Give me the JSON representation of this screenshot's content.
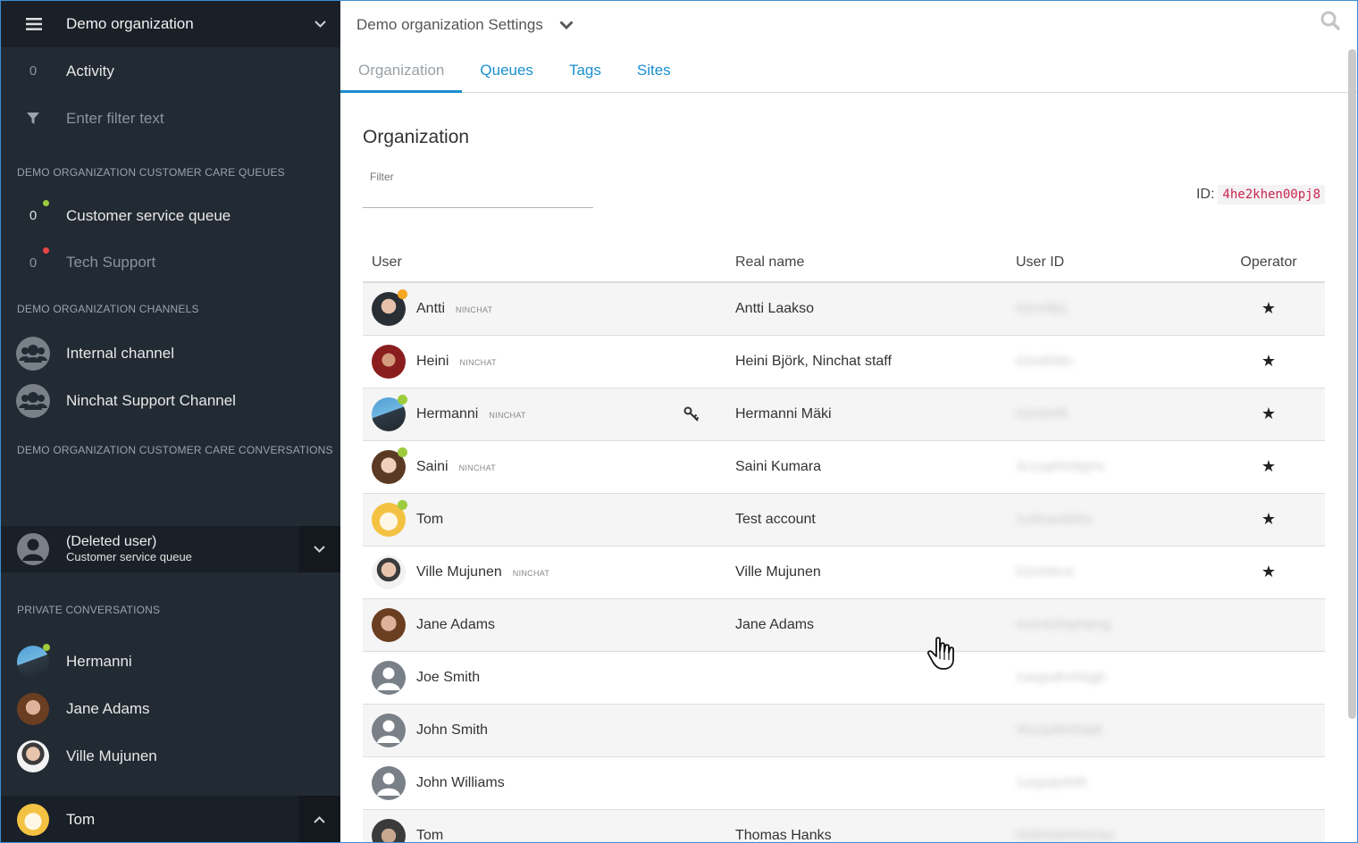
{
  "sidebar": {
    "org_name": "Demo organization",
    "activity": {
      "count": "0",
      "label": "Activity"
    },
    "filter_placeholder": "Enter filter text",
    "queues_section": "DEMO ORGANIZATION CUSTOMER CARE QUEUES",
    "queues": [
      {
        "count": "0",
        "label": "Customer service queue",
        "status_color": "#9ccc3c"
      },
      {
        "count": "0",
        "label": "Tech Support",
        "status_color": "#e84545"
      }
    ],
    "channels_section": "DEMO ORGANIZATION CHANNELS",
    "channels": [
      {
        "label": "Internal channel"
      },
      {
        "label": "Ninchat Support Channel"
      }
    ],
    "conversations_section": "DEMO ORGANIZATION CUSTOMER CARE CONVERSATIONS",
    "conversation": {
      "title": "(Deleted user)",
      "subtitle": "Customer service queue"
    },
    "private_section": "PRIVATE CONVERSATIONS",
    "private": [
      {
        "label": "Hermanni"
      },
      {
        "label": "Jane Adams"
      },
      {
        "label": "Ville Mujunen"
      }
    ],
    "current_user": "Tom"
  },
  "header": {
    "title": "Demo organization Settings",
    "tabs": [
      "Organization",
      "Queues",
      "Tags",
      "Sites"
    ]
  },
  "org": {
    "heading": "Organization",
    "filter_label": "Filter",
    "id_label": "ID:",
    "id_value": "4he2khen00pj8"
  },
  "table": {
    "columns": [
      "User",
      "Real name",
      "User ID",
      "Operator"
    ],
    "rows": [
      {
        "user": "Antti",
        "tag": "NINCHAT",
        "real": "Antti Laakso",
        "uid": "02mrllj0j",
        "operator": "★"
      },
      {
        "user": "Heini",
        "tag": "NINCHAT",
        "real": "Heini Björk, Ninchat staff",
        "uid": "02ml0l4ln",
        "operator": "★"
      },
      {
        "user": "Hermanni",
        "tag": "NINCHAT",
        "real": "Hermanni Mäki",
        "uid": "02ml04ft",
        "operator": "★"
      },
      {
        "user": "Saini",
        "tag": "NINCHAT",
        "real": "Saini Kumara",
        "uid": "3c1sqhh09gHc",
        "operator": "★"
      },
      {
        "user": "Tom",
        "tag": "",
        "real": "Test account",
        "uid": "1ul4naobbhs",
        "operator": "★"
      },
      {
        "user": "Ville Mujunen",
        "tag": "NINCHAT",
        "real": "Ville Mujunen",
        "uid": "02ml0kv4",
        "operator": "★"
      },
      {
        "user": "Jane Adams",
        "tag": "",
        "real": "Jane Adams",
        "uid": "4o3nk2lsphteng",
        "operator": ""
      },
      {
        "user": "Joe Smith",
        "tag": "",
        "real": "",
        "uid": "1segsdhvh0gjh",
        "operator": ""
      },
      {
        "user": "John Smith",
        "tag": "",
        "real": "",
        "uid": "4hx2pl9h0hijdt",
        "operator": ""
      },
      {
        "user": "John Williams",
        "tag": "",
        "real": "",
        "uid": "1sejady0hlh",
        "operator": ""
      },
      {
        "user": "Tom",
        "tag": "",
        "real": "Thomas Hanks",
        "uid": "0t0l0hd0hlh0nbo",
        "operator": ""
      }
    ]
  },
  "colors": {
    "accent": "#1a8fd0",
    "sidebar_bg": "#222a33",
    "online": "#9ccc3c",
    "away": "#f5a623",
    "offline": "#e84545"
  }
}
